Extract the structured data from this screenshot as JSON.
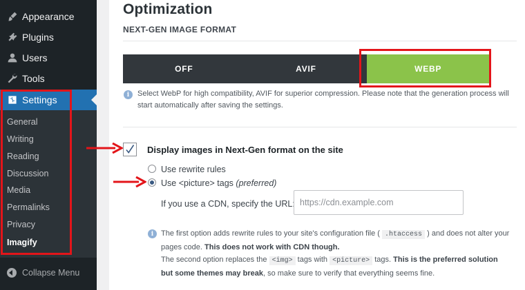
{
  "sidebar": {
    "menu": [
      {
        "label": "Appearance",
        "icon": "paintbrush-icon"
      },
      {
        "label": "Plugins",
        "icon": "plug-icon"
      },
      {
        "label": "Users",
        "icon": "user-icon"
      },
      {
        "label": "Tools",
        "icon": "wrench-icon"
      },
      {
        "label": "Settings",
        "icon": "settings-icon"
      }
    ],
    "submenu": [
      "General",
      "Writing",
      "Reading",
      "Discussion",
      "Media",
      "Permalinks",
      "Privacy",
      "Imagify"
    ],
    "collapse_label": "Collapse Menu"
  },
  "page": {
    "title": "Optimization",
    "section": "NEXT-GEN IMAGE FORMAT",
    "format_options": [
      "OFF",
      "AVIF",
      "WEBP"
    ],
    "selected_format": "WEBP",
    "format_help": "Select WebP for high compatibility, AVIF for superior compression. Please note that the generation process will start automatically after saving the settings.",
    "display_label": "Display images in Next-Gen format on the site",
    "display_checked": true,
    "radio_rewrite": "Use rewrite rules",
    "radio_picture_prefix": "Use <picture> tags",
    "radio_picture_suffix": "(preferred)",
    "selected_method": "picture",
    "cdn_label": "If you use a CDN, specify the URL:",
    "cdn_placeholder": "https://cdn.example.com",
    "cdn_value": "",
    "note": {
      "p1a": "The first option adds rewrite rules to your site's configuration file (",
      "p1code": ".htaccess",
      "p1b": ") and does not alter your pages code.",
      "p1bold": "This does not work with CDN though.",
      "p2a": "The second option replaces the",
      "p2code1": "<img>",
      "p2b": "tags with",
      "p2code2": "<picture>",
      "p2c": "tags.",
      "p2bold": "This is the preferred solution but some themes may break",
      "p2d": ", so make sure to verify that everything seems fine."
    }
  },
  "colors": {
    "accent": "#2271b1",
    "selected_format": "#8bc34a",
    "highlight": "#e3151a"
  }
}
